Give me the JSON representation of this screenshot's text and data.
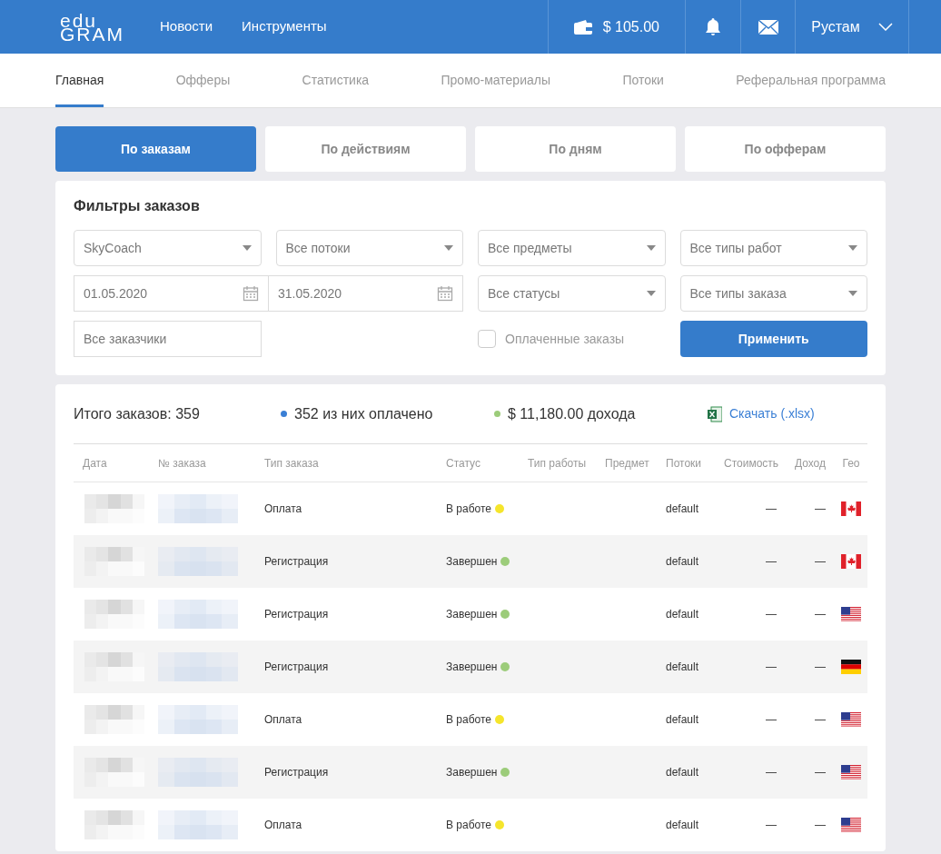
{
  "header": {
    "logo_top": "edu",
    "logo_bottom": "GRAM",
    "nav": [
      "Новости",
      "Инструменты"
    ],
    "balance": "$ 105.00",
    "user": "Рустам"
  },
  "tabs": [
    {
      "label": "Главная",
      "selected": true
    },
    {
      "label": "Офферы",
      "selected": false
    },
    {
      "label": "Статистика",
      "selected": false
    },
    {
      "label": "Промо-материалы",
      "selected": false
    },
    {
      "label": "Потоки",
      "selected": false
    },
    {
      "label": "Реферальная программа",
      "selected": false
    }
  ],
  "views": [
    {
      "label": "По заказам",
      "selected": true
    },
    {
      "label": "По действиям",
      "selected": false
    },
    {
      "label": "По дням",
      "selected": false
    },
    {
      "label": "По офферам",
      "selected": false
    }
  ],
  "filters": {
    "title": "Фильтры заказов",
    "offer": "SkyCoach",
    "streams": "Все потоки",
    "subjects": "Все предметы",
    "work_types": "Все типы работ",
    "date_from": "01.05.2020",
    "date_to": "31.05.2020",
    "statuses": "Все статусы",
    "order_types": "Все типы заказа",
    "customers": "Все заказчики",
    "paid_only": {
      "label": "Оплаченные заказы",
      "checked": false
    },
    "apply": "Применить"
  },
  "summary": {
    "total": "Итого заказов: 359",
    "stats": [
      {
        "text": "352 из них оплачено",
        "color": "#3a7fd5"
      },
      {
        "text": "$ 11,180.00 дохода",
        "color": "#9ccc7a"
      }
    ],
    "download": "Скачать (.xlsx)"
  },
  "table": {
    "columns": [
      "Дата",
      "№ заказа",
      "Тип заказа",
      "Статус",
      "Тип работы",
      "Предмет",
      "Потоки",
      "Стоимость",
      "Доход",
      "Гео"
    ],
    "rows": [
      {
        "type": "Оплата",
        "status": "В работе",
        "color": "#f5e52c",
        "stream": "default",
        "cost": "—",
        "income": "—",
        "kind": "ca"
      },
      {
        "type": "Регистрация",
        "status": "Завершен",
        "color": "#9ccc7a",
        "stream": "default",
        "cost": "—",
        "income": "—",
        "kind": "ca"
      },
      {
        "type": "Регистрация",
        "status": "Завершен",
        "color": "#9ccc7a",
        "stream": "default",
        "cost": "—",
        "income": "—",
        "kind": "us"
      },
      {
        "type": "Регистрация",
        "status": "Завершен",
        "color": "#9ccc7a",
        "stream": "default",
        "cost": "—",
        "income": "—",
        "kind": "de"
      },
      {
        "type": "Оплата",
        "status": "В работе",
        "color": "#f5e52c",
        "stream": "default",
        "cost": "—",
        "income": "—",
        "kind": "us"
      },
      {
        "type": "Регистрация",
        "status": "Завершен",
        "color": "#9ccc7a",
        "stream": "default",
        "cost": "—",
        "income": "—",
        "kind": "us"
      },
      {
        "type": "Оплата",
        "status": "В работе",
        "color": "#f5e52c",
        "stream": "default",
        "cost": "—",
        "income": "—",
        "kind": "us"
      }
    ]
  }
}
